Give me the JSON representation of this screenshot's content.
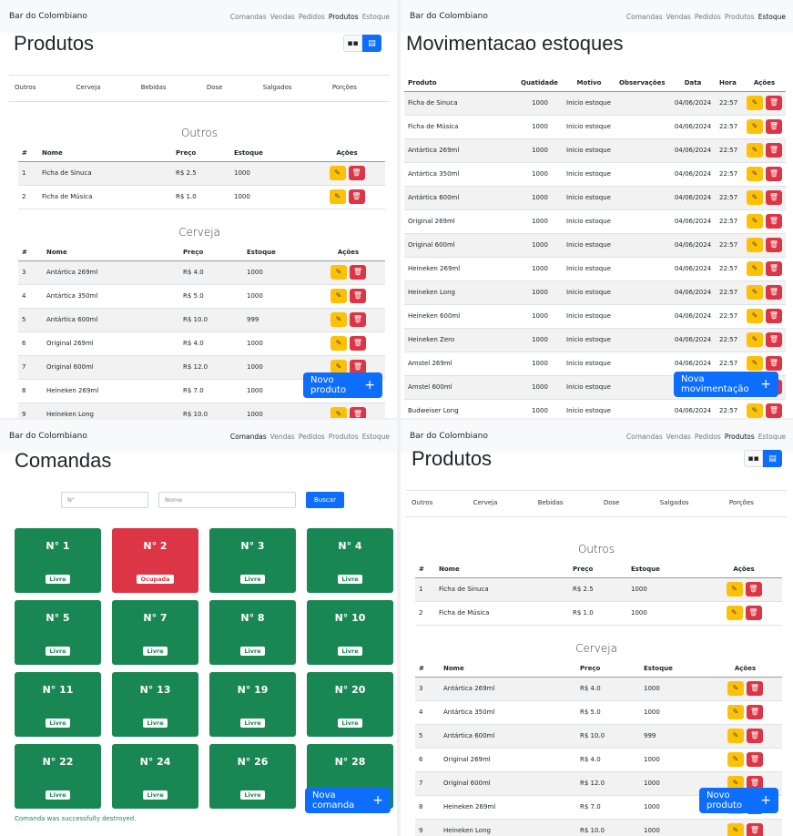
{
  "app": {
    "brand": "Bar do Colombiano",
    "nav": [
      "Comandas",
      "Vendas",
      "Pedidos",
      "Produtos",
      "Estoque"
    ]
  },
  "produtos": {
    "title": "Produtos",
    "categories": [
      "Outros",
      "Cerveja",
      "Bebidas",
      "Dose",
      "Salgados",
      "Porções"
    ],
    "headers": [
      "#",
      "Nome",
      "Preço",
      "Estoque",
      "Ações"
    ],
    "sections": [
      {
        "name": "Outros",
        "rows": [
          [
            "1",
            "Ficha de Sinuca",
            "R$ 2.5",
            "1000"
          ],
          [
            "2",
            "Ficha de Música",
            "R$ 1.0",
            "1000"
          ]
        ]
      },
      {
        "name": "Cerveja",
        "rows": [
          [
            "3",
            "Antártica 269ml",
            "R$ 4.0",
            "1000"
          ],
          [
            "4",
            "Antártica 350ml",
            "R$ 5.0",
            "1000"
          ],
          [
            "5",
            "Antártica 600ml",
            "R$ 10.0",
            "999"
          ],
          [
            "6",
            "Original 269ml",
            "R$ 4.0",
            "1000"
          ],
          [
            "7",
            "Original 600ml",
            "R$ 12.0",
            "1000"
          ],
          [
            "8",
            "Heineken 269ml",
            "R$ 7.0",
            "1000"
          ],
          [
            "9",
            "Heineken Long",
            "R$ 10.0",
            "1000"
          ]
        ]
      }
    ],
    "new_button": "Novo produto"
  },
  "movimentacao": {
    "title": "Movimentacao estoques",
    "headers": [
      "Produto",
      "Quatidade",
      "Motivo",
      "Observações",
      "Data",
      "Hora",
      "Ações"
    ],
    "rows": [
      [
        "Ficha de Sinuca",
        "1000",
        "Inicio estoque",
        "",
        "04/06/2024",
        "22:57"
      ],
      [
        "Ficha de Música",
        "1000",
        "Inicio estoque",
        "",
        "04/06/2024",
        "22:57"
      ],
      [
        "Antártica 269ml",
        "1000",
        "Inicio estoque",
        "",
        "04/06/2024",
        "22:57"
      ],
      [
        "Antártica 350ml",
        "1000",
        "Inicio estoque",
        "",
        "04/06/2024",
        "22:57"
      ],
      [
        "Antártica 600ml",
        "1000",
        "Inicio estoque",
        "",
        "04/06/2024",
        "22:57"
      ],
      [
        "Original 269ml",
        "1000",
        "Inicio estoque",
        "",
        "04/06/2024",
        "22:57"
      ],
      [
        "Original 600ml",
        "1000",
        "Inicio estoque",
        "",
        "04/06/2024",
        "22:57"
      ],
      [
        "Heineken 269ml",
        "1000",
        "Inicio estoque",
        "",
        "04/06/2024",
        "22:57"
      ],
      [
        "Heineken Long",
        "1000",
        "Inicio estoque",
        "",
        "04/06/2024",
        "22:57"
      ],
      [
        "Heineken 600ml",
        "1000",
        "Inicio estoque",
        "",
        "04/06/2024",
        "22:57"
      ],
      [
        "Heineken Zero",
        "1000",
        "Inicio estoque",
        "",
        "04/06/2024",
        "22:57"
      ],
      [
        "Amstel 269ml",
        "1000",
        "Inicio estoque",
        "",
        "04/06/2024",
        "22:57"
      ],
      [
        "Amstel 600ml",
        "1000",
        "Inicio estoque",
        "",
        "04/06/2024",
        "22:57"
      ],
      [
        "Budweiser Long",
        "1000",
        "Inicio estoque",
        "",
        "04/06/2024",
        "22:57"
      ]
    ],
    "new_button": "Nova movimentação"
  },
  "comandas": {
    "title": "Comandas",
    "search": {
      "num_placeholder": "N°",
      "name_placeholder": "Nome",
      "button": "Buscar"
    },
    "cards": [
      {
        "num": "N° 1",
        "status": "Livre"
      },
      {
        "num": "N° 2",
        "status": "Ocupada"
      },
      {
        "num": "N° 3",
        "status": "Livre"
      },
      {
        "num": "N° 4",
        "status": "Livre"
      },
      {
        "num": "N° 5",
        "status": "Livre"
      },
      {
        "num": "N° 7",
        "status": "Livre"
      },
      {
        "num": "N° 8",
        "status": "Livre"
      },
      {
        "num": "N° 10",
        "status": "Livre"
      },
      {
        "num": "N° 11",
        "status": "Livre"
      },
      {
        "num": "N° 13",
        "status": "Livre"
      },
      {
        "num": "N° 19",
        "status": "Livre"
      },
      {
        "num": "N° 20",
        "status": "Livre"
      },
      {
        "num": "N° 22",
        "status": "Livre"
      },
      {
        "num": "N° 24",
        "status": "Livre"
      },
      {
        "num": "N° 26",
        "status": "Livre"
      },
      {
        "num": "N° 28",
        "status": "Livre"
      }
    ],
    "flash": "Comanda was successfully destroyed.",
    "new_button": "Nova comanda"
  },
  "icons": {
    "edit": "pencil-icon",
    "delete": "trash-icon",
    "grid": "grid-icon",
    "list": "table-icon",
    "add": "plus-icon"
  },
  "colors": {
    "primary": "#0d6efd",
    "warning": "#ffc107",
    "danger": "#dc3545",
    "success": "#198754"
  }
}
